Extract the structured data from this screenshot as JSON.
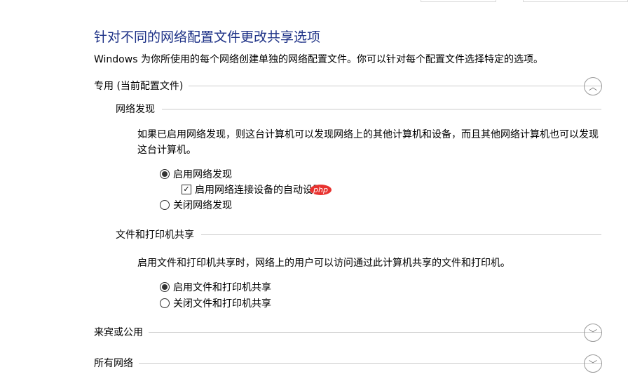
{
  "title": "针对不同的网络配置文件更改共享选项",
  "description": "Windows 为你所使用的每个网络创建单独的网络配置文件。你可以针对每个配置文件选择特定的选项。",
  "private": {
    "label": "专用 (当前配置文件)",
    "discovery": {
      "heading": "网络发现",
      "text": "如果已启用网络发现，则这台计算机可以发现网络上的其他计算机和设备，而且其他网络计算机也可以发现这台计算机。",
      "on": "启用网络发现",
      "auto": "启用网络连接设备的自动设置",
      "off": "关闭网络发现"
    },
    "sharing": {
      "heading": "文件和打印机共享",
      "text": "启用文件和打印机共享时，网络上的用户可以访问通过此计算机共享的文件和打印机。",
      "on": "启用文件和打印机共享",
      "off": "关闭文件和打印机共享"
    }
  },
  "guest": {
    "label": "来宾或公用"
  },
  "all": {
    "label": "所有网络"
  },
  "watermark": "php 中文网"
}
